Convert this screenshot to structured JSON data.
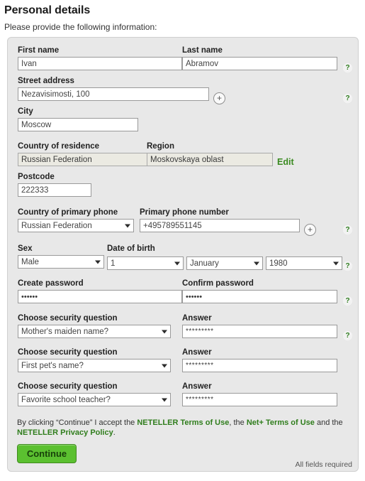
{
  "header": {
    "title": "Personal details",
    "subtitle": "Please provide the following information:"
  },
  "icons": {
    "help": "?",
    "plus": "+"
  },
  "colors": {
    "accent_green": "#2f7d1c",
    "button_green": "#5bc030",
    "panel_bg": "#e8e8e8",
    "readonly_bg": "#ebeae2"
  },
  "form": {
    "first_name": {
      "label": "First name",
      "value": "Ivan"
    },
    "last_name": {
      "label": "Last name",
      "value": "Abramov"
    },
    "street_address": {
      "label": "Street address",
      "value": "Nezavisimosti, 100"
    },
    "city": {
      "label": "City",
      "value": "Moscow"
    },
    "country_of_residence": {
      "label": "Country of residence",
      "value": "Russian Federation"
    },
    "region": {
      "label": "Region",
      "value": "Moskovskaya oblast"
    },
    "edit_link": "Edit",
    "postcode": {
      "label": "Postcode",
      "value": "222333"
    },
    "country_of_primary_phone": {
      "label": "Country of primary phone",
      "value": "Russian Federation"
    },
    "primary_phone_number": {
      "label": "Primary phone number",
      "value": "+495789551145"
    },
    "sex": {
      "label": "Sex",
      "value": "Male"
    },
    "date_of_birth": {
      "label": "Date of birth",
      "day": "1",
      "month": "January",
      "year": "1980"
    },
    "create_password": {
      "label": "Create password",
      "value": "••••••"
    },
    "confirm_password": {
      "label": "Confirm password",
      "value": "••••••"
    },
    "security_questions": [
      {
        "label": "Choose security question",
        "question": "Mother's maiden name?",
        "answer_label": "Answer",
        "answer": "*********"
      },
      {
        "label": "Choose security question",
        "question": "First pet's name?",
        "answer_label": "Answer",
        "answer": "*********"
      },
      {
        "label": "Choose security question",
        "question": "Favorite school teacher?",
        "answer_label": "Answer",
        "answer": "*********"
      }
    ]
  },
  "footer": {
    "terms_prefix": "By clicking “Continue” I accept the ",
    "terms_link_1": "NETELLER Terms of Use",
    "terms_mid_1": ", the ",
    "terms_link_2": "Net+ Terms of Use",
    "terms_mid_2": " and the ",
    "terms_link_3": "NETELLER Privacy Policy",
    "terms_suffix": ".",
    "continue_button": "Continue",
    "all_fields_required": "All fields required"
  }
}
